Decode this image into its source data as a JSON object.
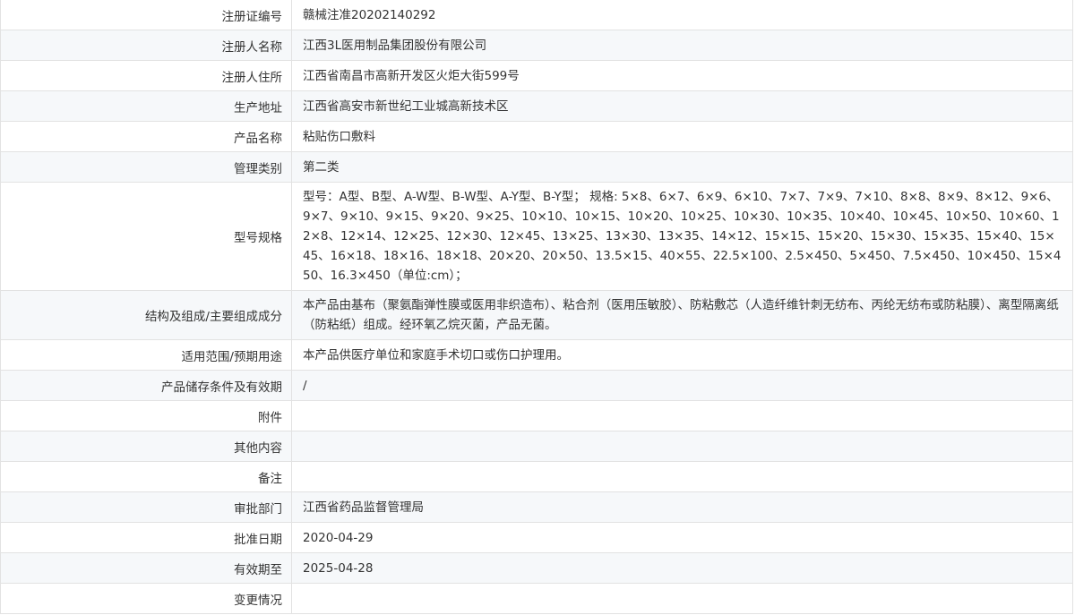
{
  "rows": [
    {
      "label": "注册证编号",
      "value": "赣械注准20202140292"
    },
    {
      "label": "注册人名称",
      "value": "江西3L医用制品集团股份有限公司"
    },
    {
      "label": "注册人住所",
      "value": "江西省南昌市高新开发区火炬大街599号"
    },
    {
      "label": "生产地址",
      "value": "江西省高安市新世纪工业城高新技术区"
    },
    {
      "label": "产品名称",
      "value": "粘贴伤口敷料"
    },
    {
      "label": "管理类别",
      "value": "第二类"
    },
    {
      "label": "型号规格",
      "value": "型号：A型、B型、A-W型、B-W型、A-Y型、B-Y型； 规格: 5×8、6×7、6×9、6×10、7×7、7×9、7×10、8×8、8×9、8×12、9×6、9×7、9×10、9×15、9×20、9×25、10×10、10×15、10×20、10×25、10×30、10×35、10×40、10×45、10×50、10×60、12×8、12×14、12×25、12×30、12×45、13×25、13×30、13×35、14×12、15×15、15×20、15×30、15×35、15×40、15×45、16×18、18×16、18×18、20×20、20×50、13.5×15、40×55、22.5×100、2.5×450、5×450、7.5×450、10×450、15×450、16.3×450（单位:cm）；"
    },
    {
      "label": "结构及组成/主要组成成分",
      "value": "本产品由基布（聚氨酯弹性膜或医用非织造布）、粘合剂（医用压敏胶）、防粘敷芯（人造纤维针刺无纺布、丙纶无纺布或防粘膜）、离型隔离纸（防粘纸）组成。经环氧乙烷灭菌，产品无菌。"
    },
    {
      "label": "适用范围/预期用途",
      "value": "本产品供医疗单位和家庭手术切口或伤口护理用。"
    },
    {
      "label": "产品储存条件及有效期",
      "value": "/"
    },
    {
      "label": "附件",
      "value": ""
    },
    {
      "label": "其他内容",
      "value": ""
    },
    {
      "label": "备注",
      "value": ""
    },
    {
      "label": "审批部门",
      "value": "江西省药品监督管理局"
    },
    {
      "label": "批准日期",
      "value": "2020-04-29"
    },
    {
      "label": "有效期至",
      "value": "2025-04-28"
    },
    {
      "label": "变更情况",
      "value": ""
    }
  ]
}
